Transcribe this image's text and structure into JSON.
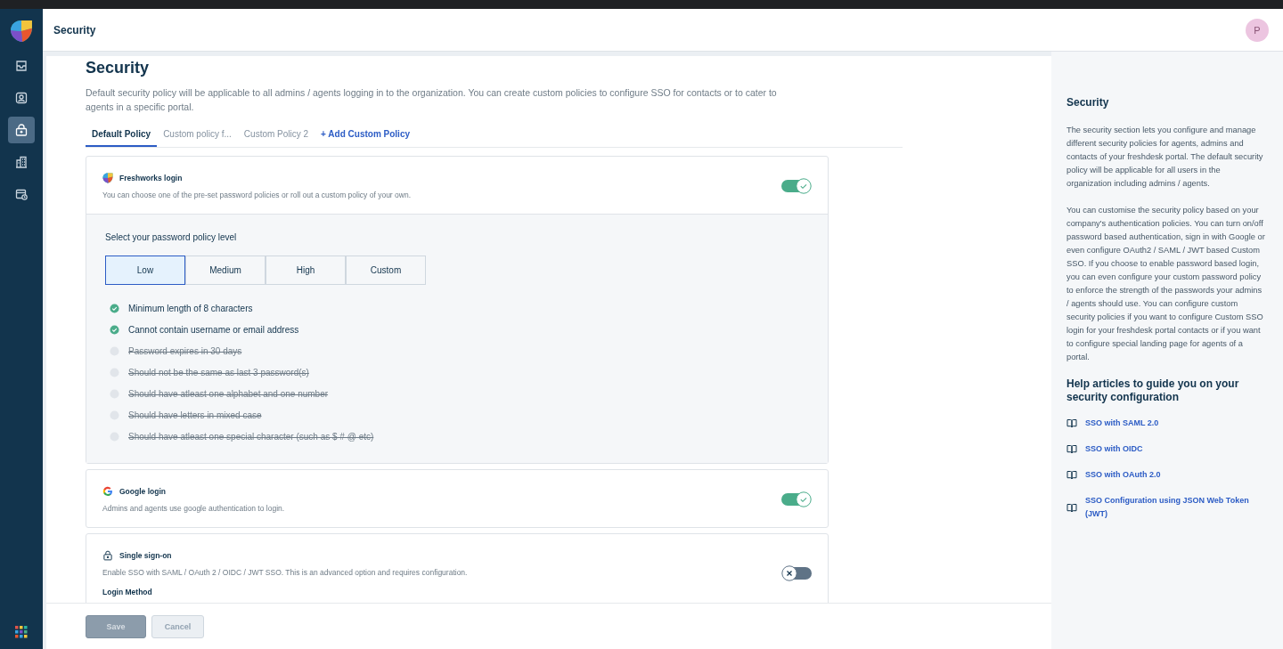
{
  "sidebar": {
    "items": [
      {
        "kind": "inbox",
        "selected": false
      },
      {
        "kind": "contact",
        "selected": false
      },
      {
        "kind": "security",
        "selected": true
      },
      {
        "kind": "building",
        "selected": false
      },
      {
        "kind": "calendar",
        "selected": false
      }
    ]
  },
  "header": {
    "title": "Security",
    "avatar": "P"
  },
  "page": {
    "title": "Security",
    "description": "Default security policy will be applicable to all admins / agents logging in to the organization. You can create custom policies to configure SSO for contacts or to cater to agents in a specific portal.",
    "tabs": [
      {
        "label": "Default Policy",
        "selected": true
      },
      {
        "label": "Custom policy f...",
        "selected": false
      },
      {
        "label": "Custom Policy 2",
        "selected": false
      }
    ],
    "add_policy": "+ Add Custom Policy"
  },
  "login_methods": [
    {
      "kind": "freshworks",
      "title": "Freshworks login",
      "description": "You can choose one of the pre-set password policies or roll out a custom policy of your own.",
      "on": true,
      "policy": {
        "heading": "Select your password policy level",
        "levels": [
          {
            "label": "Low",
            "selected": true
          },
          {
            "label": "Medium",
            "selected": false
          },
          {
            "label": "High",
            "selected": false
          },
          {
            "label": "Custom",
            "selected": false
          }
        ],
        "rules": [
          {
            "text": "Minimum length of 8 characters",
            "met": true
          },
          {
            "text": "Cannot contain username or email address",
            "met": true
          },
          {
            "text": "Password expires in 30 days",
            "met": false
          },
          {
            "text": "Should not be the same as last 3 password(s)",
            "met": false
          },
          {
            "text": "Should have atleast one alphabet and one number",
            "met": false
          },
          {
            "text": "Should have letters in mixed case",
            "met": false
          },
          {
            "text": "Should have atleast one special character (such as $ # @ etc)",
            "met": false
          }
        ]
      }
    },
    {
      "kind": "google",
      "title": "Google login",
      "description": "Admins and agents use google authentication to login.",
      "on": true
    },
    {
      "kind": "sso",
      "title": "Single sign-on",
      "description": "Enable SSO with SAML / OAuth 2 / OIDC / JWT SSO. This is an advanced option and requires configuration.",
      "on": false,
      "subheading": "Login Method"
    }
  ],
  "footer": {
    "buttons": [
      {
        "kind": "primary",
        "label": "Save",
        "disabled": true
      },
      {
        "kind": "secondary",
        "label": "Cancel",
        "disabled": true
      }
    ]
  },
  "help": {
    "title": "Security",
    "paragraphs": [
      "The security section lets you configure and manage different security policies for agents, admins and contacts of your freshdesk portal. The default security policy will be applicable for all users in the organization including admins / agents.",
      "You can customise the security policy based on your company's authentication policies. You can turn on/off password based authentication, sign in with Google or even configure OAuth2 / SAML / JWT based Custom SSO. If you choose to enable password based login, you can even configure your custom password policy to enforce the strength of the passwords your admins / agents should use. You can configure custom security policies if you want to configure Custom SSO login for your freshdesk portal contacts or if you want to configure special landing page for agents of a portal."
    ],
    "articles_heading": "Help articles to guide you on your security configuration",
    "articles": [
      "SSO with SAML 2.0",
      "SSO with OIDC",
      "SSO with OAuth 2.0",
      "SSO Configuration using JSON Web Token (JWT)"
    ]
  }
}
